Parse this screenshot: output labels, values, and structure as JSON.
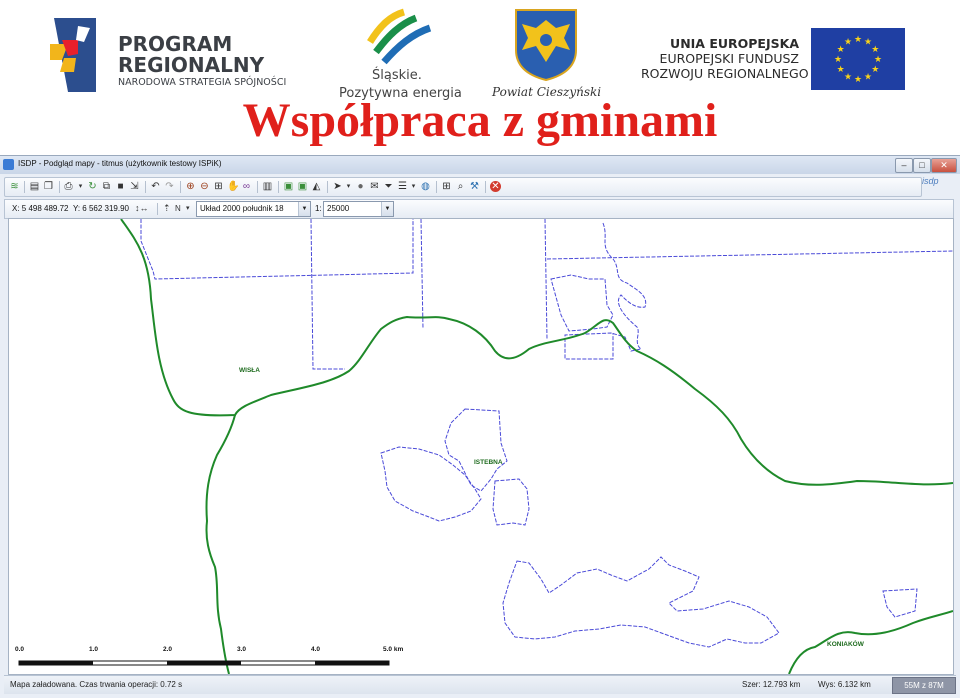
{
  "banner": {
    "program_title_1": "PROGRAM",
    "program_title_2": "REGIONALNY",
    "program_subtitle": "NARODOWA STRATEGIA SPÓJNOŚCI",
    "slaskie_line1": "Śląskie.",
    "slaskie_line2": "Pozytywna energia",
    "powiat": "Powiat Cieszyński",
    "eu_line1": "UNIA EUROPEJSKA",
    "eu_line2": "EUROPEJSKI FUNDUSZ",
    "eu_line3": "ROZWOJU REGIONALNEGO",
    "title": "Współpraca z gminami"
  },
  "window": {
    "title": "ISDP - Podgląd mapy - titmus (użytkownik testowy ISPiK)",
    "isdp_logo": "isdp"
  },
  "coordbar": {
    "x_label": "X: 5 498 489.72",
    "y_label": "Y: 6 562 319.90",
    "north": "N",
    "crs": "Układ 2000 południk 18",
    "scale_prefix": "1:",
    "scale_value": "25000"
  },
  "map": {
    "places": {
      "wisla": "WISŁA",
      "istebna": "ISTEBNA",
      "koniakow": "KONIAKÓW"
    },
    "scale_ticks": [
      "0.0",
      "1.0",
      "2.0",
      "3.0",
      "4.0",
      "5.0 km"
    ]
  },
  "status": {
    "message": "Mapa załadowana. Czas trwania operacji: 0.72 s",
    "width": "Szer: 12.793 km",
    "height": "Wys: 6.132 km",
    "memory": "55M z 87M"
  },
  "colors": {
    "title_red": "#e0201b",
    "boundary_green": "#1f8a2a",
    "parcel_blue": "#3a3ad0"
  }
}
